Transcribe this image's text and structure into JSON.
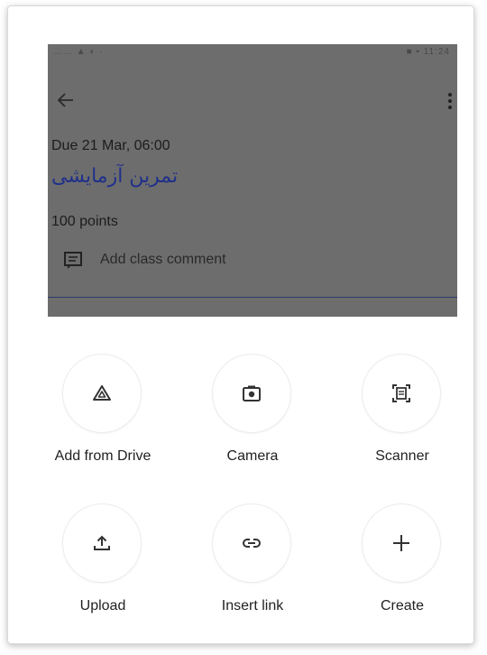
{
  "statusbar": {
    "left": "…… ▲ ◐ ·",
    "right": "■ ▪ 11:24"
  },
  "assignment": {
    "due": "Due 21 Mar, 06:00",
    "title": "تمرین آزمایشی",
    "points": "100 points",
    "comment_label": "Add class comment"
  },
  "actions": [
    {
      "label": "Add from Drive",
      "icon": "drive-icon"
    },
    {
      "label": "Camera",
      "icon": "camera-icon"
    },
    {
      "label": "Scanner",
      "icon": "scanner-icon"
    },
    {
      "label": "Upload",
      "icon": "upload-icon"
    },
    {
      "label": "Insert link",
      "icon": "link-icon"
    },
    {
      "label": "Create",
      "icon": "plus-icon"
    }
  ],
  "colors": {
    "overlay": "#6d6d6d",
    "title": "#20308a",
    "icon": "#333333"
  }
}
